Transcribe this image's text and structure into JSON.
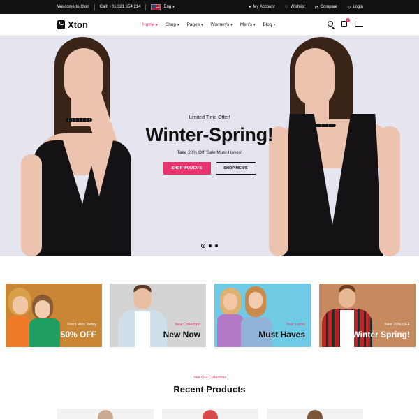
{
  "topbar": {
    "welcome": "Welcome to Xton",
    "phone": "Call: +01 321 654 214",
    "language": "Eng",
    "my_account": "My Account",
    "wishlist": "Wishlist",
    "compare": "Compare",
    "login": "Login"
  },
  "header": {
    "logo": "Xton",
    "nav": [
      "Home",
      "Shop",
      "Pages",
      "Women's",
      "Men's",
      "Blog"
    ],
    "active_nav": "Home",
    "cart_count": "0"
  },
  "hero": {
    "subtitle": "Limited Time Offer!",
    "title": "Winter-Spring!",
    "description": "Take 20% Off 'Sale Must-Haves'",
    "btn_primary": "SHOP WOMEN'S",
    "btn_secondary": "SHOP MEN'S",
    "slide_count": 3,
    "active_slide": 1
  },
  "banners": [
    {
      "tag": "Don't Miss Today",
      "title": "50% OFF",
      "bg": "#c98636"
    },
    {
      "tag": "New Collection",
      "title": "New Now",
      "bg": "#d3d3d3"
    },
    {
      "tag": "Your Looks",
      "title": "Must Haves",
      "bg": "#6fcbe4"
    },
    {
      "tag": "Take 20% OFF",
      "title": "Winter Spring!",
      "bg": "#c58a5e"
    }
  ],
  "section": {
    "subtitle": "See Our Collection",
    "title": "Recent Products"
  },
  "colors": {
    "accent": "#e8336d",
    "topbar": "#111111",
    "hero_bg": "#e5e5ef"
  }
}
